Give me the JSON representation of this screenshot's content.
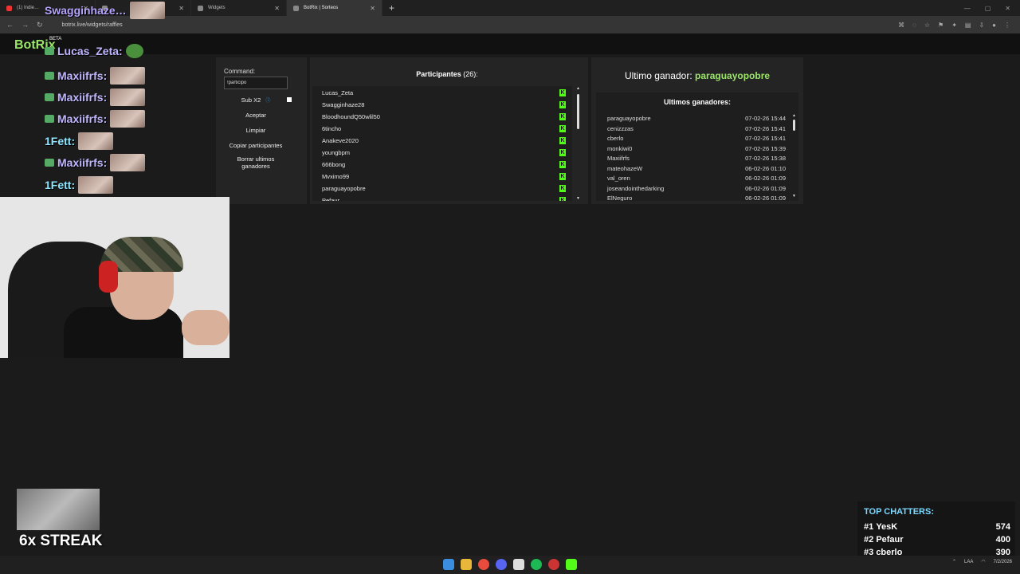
{
  "browser": {
    "tabs": [
      {
        "title": "(1) Indie…",
        "icon": "youtube-icon"
      },
      {
        "title": "",
        "icon": "tab-icon"
      },
      {
        "title": "Widgets",
        "icon": "tab-icon"
      },
      {
        "title": "BotRix | Sorteos",
        "icon": "botrix-icon"
      }
    ],
    "new_tab": "+",
    "url": "botrix.live/widgets/raffles"
  },
  "site": {
    "brand": "BotRix",
    "beta": "BETA"
  },
  "chat_overlay": [
    {
      "name": "Swagginhaze…"
    },
    {
      "name": "Lucas_Zeta:"
    },
    {
      "name": "Maxiifrfs:"
    },
    {
      "name": "Maxiifrfs:"
    },
    {
      "name": "Maxiifrfs:"
    },
    {
      "name": "1Fett:"
    },
    {
      "name": "Maxiifrfs:"
    },
    {
      "name": "1Fett:"
    }
  ],
  "controls": {
    "command_label": "Command:",
    "command_value": "!participo",
    "sub_label": "Sub X2",
    "info_icon": "ⓘ",
    "accept": "Aceptar",
    "clear": "Limpiar",
    "copy": "Copiar participantes",
    "delete_line1": "Borrar ultimos",
    "delete_line2": "ganadores"
  },
  "participants": {
    "title": "Participantes",
    "count": "(26):",
    "list": [
      "Lucas_Zeta",
      "Swagginhaze28",
      "BloodhoundQ50wlil50",
      "6tincho",
      "Anakeve2020",
      "youngbpm",
      "666bong",
      "Mvximo99",
      "paraguayopobre",
      "Pefaur"
    ],
    "kick_icon": "K"
  },
  "winner": {
    "label": "Ultimo ganador:",
    "name": "paraguayopobre",
    "list_title": "Ultimos ganadores:",
    "list": [
      {
        "name": "paraguayopobre",
        "date": "07-02-26 15:44"
      },
      {
        "name": "cenizzzas",
        "date": "07-02-26 15:41"
      },
      {
        "name": "cberlo",
        "date": "07-02-26 15:41"
      },
      {
        "name": "monkiwi0",
        "date": "07-02-26 15:39"
      },
      {
        "name": "Maxiifrfs",
        "date": "07-02-26 15:38"
      },
      {
        "name": "mateohazeW",
        "date": "06-02-26 01:10"
      },
      {
        "name": "val_oren",
        "date": "06-02-26 01:09"
      },
      {
        "name": "joseandointhedarking",
        "date": "06-02-26 01:09"
      },
      {
        "name": "ElNeguro",
        "date": "06-02-26 01:09"
      }
    ]
  },
  "streak": "6x STREAK",
  "top_chatters": {
    "title": "TOP CHATTERS:",
    "rows": [
      {
        "rank": "#1",
        "name": "YesK",
        "score": "574"
      },
      {
        "rank": "#2",
        "name": "Pefaur",
        "score": "400"
      },
      {
        "rank": "#3",
        "name": "cberlo",
        "score": "390"
      }
    ]
  },
  "tray": {
    "lang": "LAA",
    "date": "7/2/2026"
  }
}
